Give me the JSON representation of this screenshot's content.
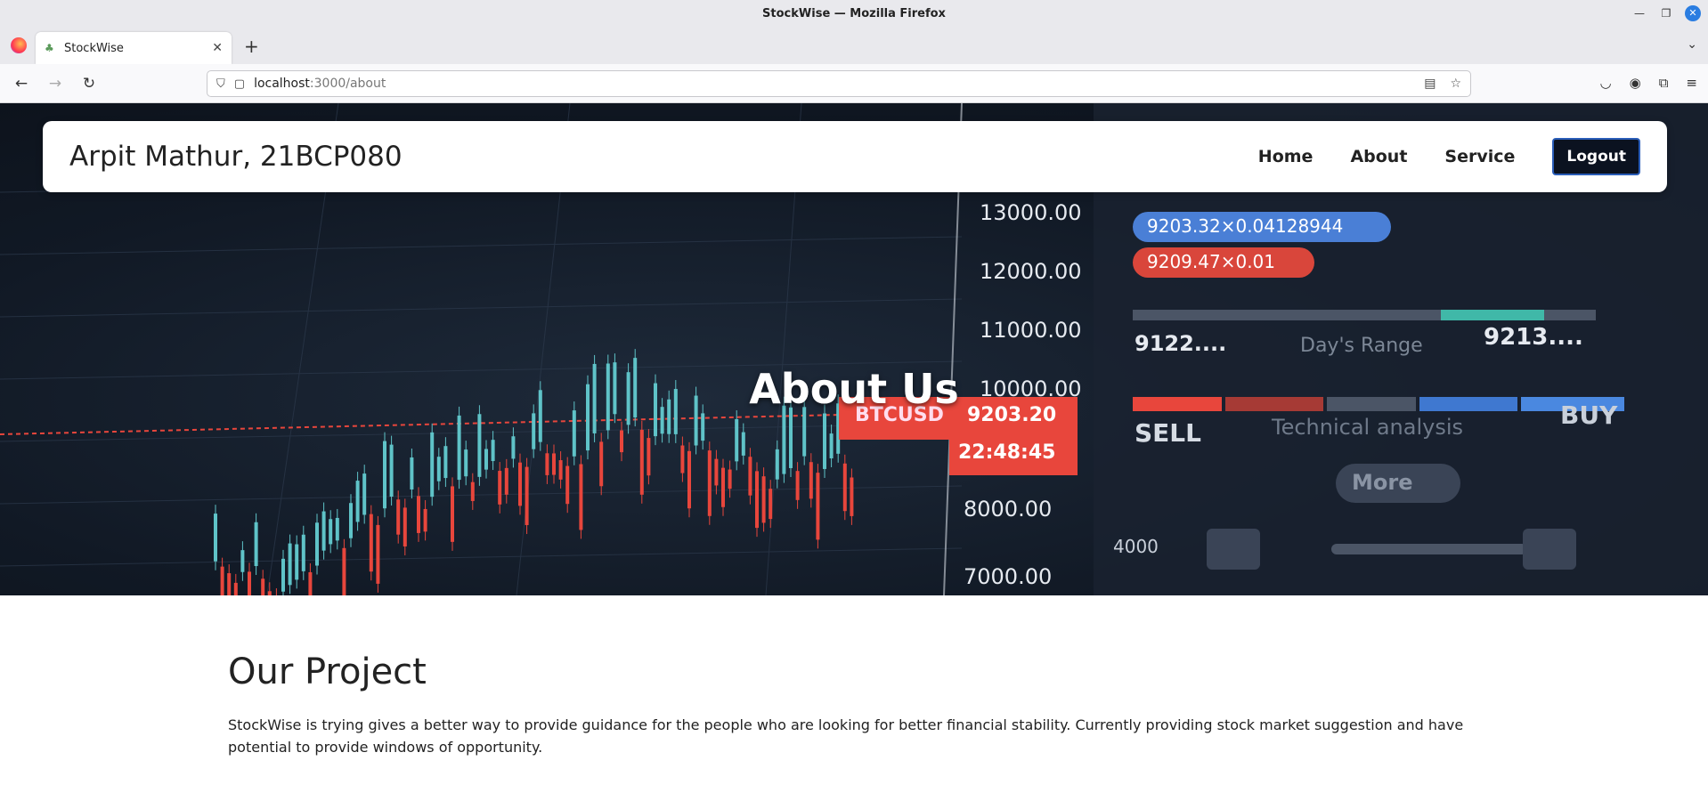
{
  "window": {
    "title": "StockWise — Mozilla Firefox"
  },
  "tab": {
    "label": "StockWise"
  },
  "address": {
    "host": "localhost",
    "path": ":3000/about"
  },
  "navbar": {
    "brand": "Arpit Mathur, 21BCP080",
    "links": [
      "Home",
      "About",
      "Service"
    ],
    "logout": "Logout"
  },
  "hero": {
    "title": "About Us",
    "prices": [
      "13000.00",
      "12000.00",
      "11000.00",
      "10000.00",
      "8000.00",
      "7000.00"
    ],
    "ticker": "BTCUSD",
    "ticker_price": "9203.20",
    "ticker_time": "22:48:45",
    "bid": "9203.32×0.04128944",
    "ask": "9209.47×0.01",
    "range_low": "9122....",
    "range_label": "Day's Range",
    "range_high": "9213....",
    "sell": "SELL",
    "tech": "Technical analysis",
    "buy": "BUY",
    "more": "More",
    "qty": "4000"
  },
  "project": {
    "heading": "Our Project",
    "body": "StockWise is trying gives a better way to provide guidance for the people who are looking for better financial stability. Currently providing stock market suggestion and have potential to provide windows of opportunity."
  },
  "colors": {
    "up": "#5fc3c8",
    "down": "#e8463c",
    "nav_bg": "#ffffff",
    "logout_bg": "#0b1220"
  }
}
